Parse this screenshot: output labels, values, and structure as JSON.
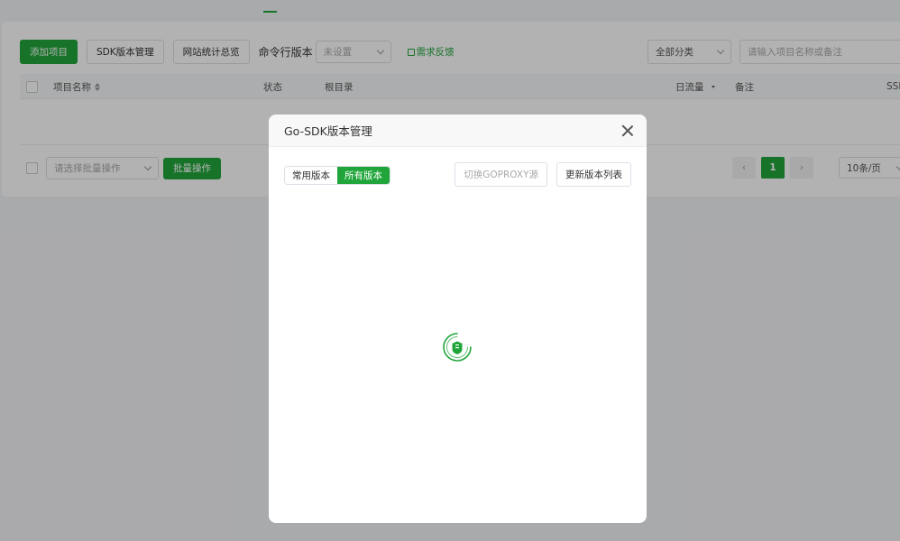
{
  "toolbar": {
    "add_project": "添加项目",
    "sdk_manage": "SDK版本管理",
    "site_stats": "网站统计总览",
    "cli_version_label": "命令行版本",
    "cli_version_select": "未设置",
    "feedback": "需求反馈",
    "category_select": "全部分类",
    "search_placeholder": "请输入项目名称或备注"
  },
  "table": {
    "headers": {
      "name": "项目名称",
      "status": "状态",
      "root": "根目录",
      "daily_traffic": "日流量",
      "remark": "备注",
      "ssl": "SSL"
    }
  },
  "footer": {
    "batch_select": "请选择批量操作",
    "batch_button": "批量操作",
    "pager": {
      "current_page": "1",
      "page_size": "10条/页"
    }
  },
  "modal": {
    "title": "Go-SDK版本管理",
    "tabs": [
      "常用版本",
      "所有版本"
    ],
    "active_tab": "所有版本",
    "switch_proxy": "切换GOPROXY源",
    "refresh_list": "更新版本列表"
  },
  "colors": {
    "accent": "#20a53a",
    "overlay": "rgba(0,0,0,0.3)"
  }
}
